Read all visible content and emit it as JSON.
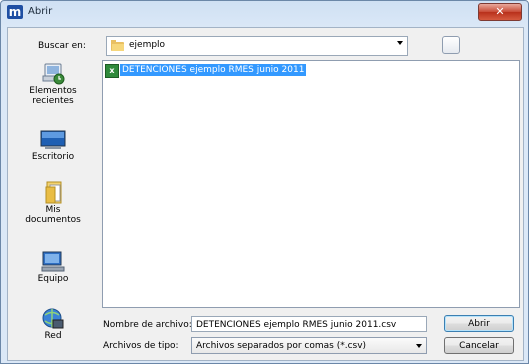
{
  "window": {
    "title": "Abrir",
    "app_icon_letter": "m",
    "close_glyph": "✕"
  },
  "look_in": {
    "label": "Buscar en:",
    "value": "ejemplo"
  },
  "places": [
    {
      "label_line1": "Elementos",
      "label_line2": "recientes",
      "icon": "recent-items-icon"
    },
    {
      "label_line1": "Escritorio",
      "label_line2": "",
      "icon": "desktop-icon"
    },
    {
      "label_line1": "Mis",
      "label_line2": "documentos",
      "icon": "documents-icon"
    },
    {
      "label_line1": "Equipo",
      "label_line2": "",
      "icon": "computer-icon"
    },
    {
      "label_line1": "Red",
      "label_line2": "",
      "icon": "network-icon"
    }
  ],
  "files": [
    {
      "name": "DETENCIONES ejemplo RMES junio 2011",
      "icon": "csv-file-icon",
      "selected": true
    }
  ],
  "file_name": {
    "label": "Nombre de archivo:",
    "value": "DETENCIONES ejemplo RMES junio 2011.csv"
  },
  "file_type": {
    "label": "Archivos de tipo:",
    "value": "Archivos separados por comas (*.csv)"
  },
  "buttons": {
    "open": "Abrir",
    "cancel": "Cancelar"
  },
  "colors": {
    "selection": "#3399ff",
    "close_button": "#c84a36",
    "title_gradient": "#cfe0f3"
  }
}
